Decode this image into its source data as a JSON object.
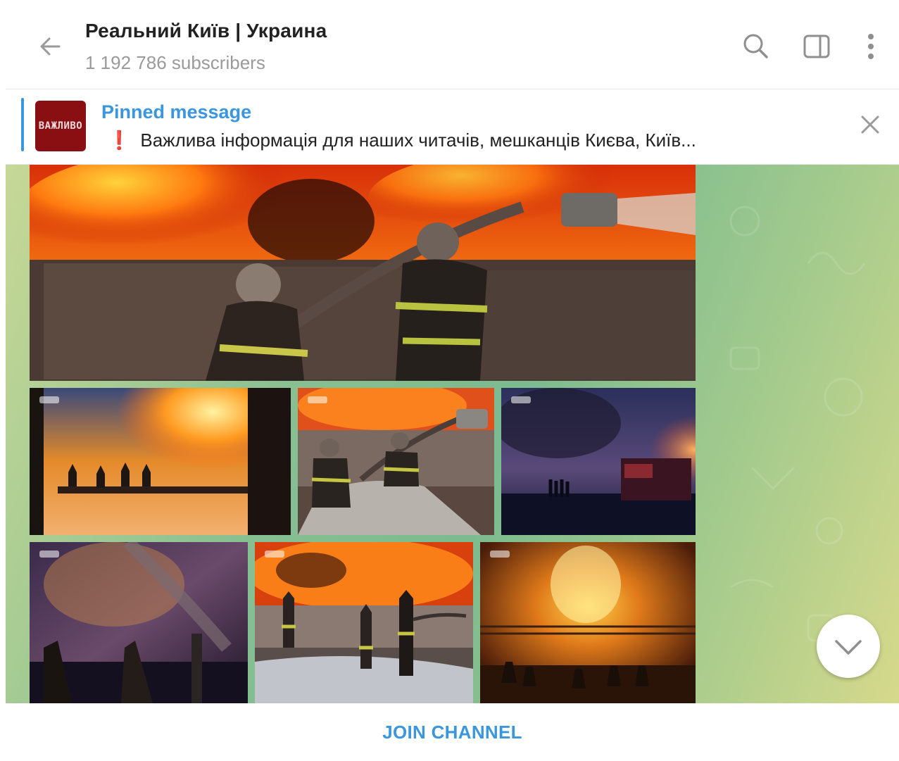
{
  "header": {
    "title": "Реальний Київ | Украина",
    "subtitle": "1 192 786 subscribers",
    "icons": [
      "back-arrow-icon",
      "search-icon",
      "sidebar-toggle-icon",
      "more-vertical-icon"
    ]
  },
  "pinned": {
    "label": "Pinned message",
    "thumb_text": "ВАЖЛИВО",
    "excl": "❗",
    "text": "Важлива інформація для наших читачів, мешканців Києва, Київ..."
  },
  "colors": {
    "accent": "#3a96dd",
    "pin_thumb": "#8a0f12"
  },
  "join": {
    "label": "JOIN CHANNEL"
  }
}
